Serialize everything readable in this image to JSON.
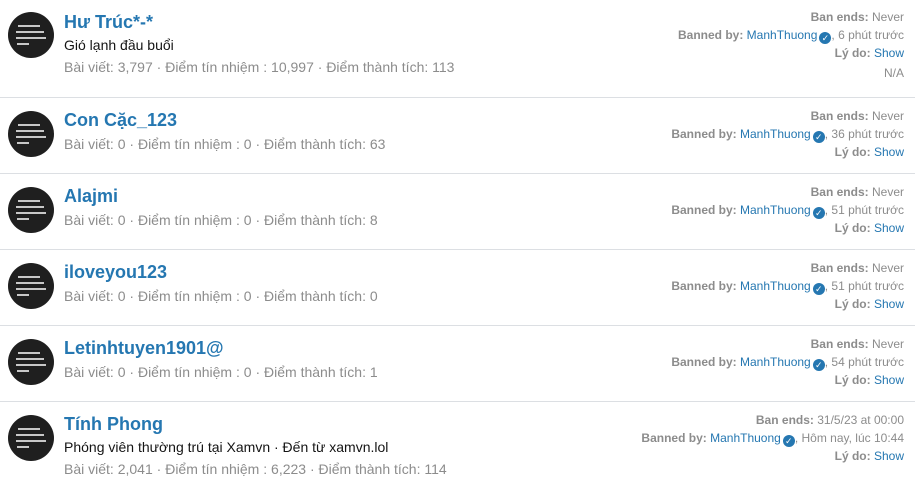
{
  "labels": {
    "ban_ends": "Ban ends:",
    "banned_by": "Banned by:",
    "reason": "Lý do:",
    "show": "Show",
    "stats_posts": "Bài viết:",
    "stats_reputation": "Điểm tín nhiệm :",
    "stats_achievements": "Điểm thành tích:",
    "sep": " · ",
    "comma": ", "
  },
  "icons": {
    "avatar": "avatar-image",
    "verified": "verified-check-icon"
  },
  "users": [
    {
      "name": "Hư Trúc*-*",
      "blurb": "Gió lạnh đầu buổi",
      "posts": "3,797",
      "reputation": "10,997",
      "achievements": "113",
      "ban_ends": "Never",
      "banned_by": "ManhThuong",
      "banned_when": "6 phút trước",
      "extra": "N/A"
    },
    {
      "name": "Con Cặc_123",
      "posts": "0",
      "reputation": "0",
      "achievements": "63",
      "ban_ends": "Never",
      "banned_by": "ManhThuong",
      "banned_when": "36 phút trước"
    },
    {
      "name": "Alajmi",
      "posts": "0",
      "reputation": "0",
      "achievements": "8",
      "ban_ends": "Never",
      "banned_by": "ManhThuong",
      "banned_when": "51 phút trước"
    },
    {
      "name": "iloveyou123",
      "posts": "0",
      "reputation": "0",
      "achievements": "0",
      "ban_ends": "Never",
      "banned_by": "ManhThuong",
      "banned_when": "51 phút trước"
    },
    {
      "name": "Letinhtuyen1901@",
      "posts": "0",
      "reputation": "0",
      "achievements": "1",
      "ban_ends": "Never",
      "banned_by": "ManhThuong",
      "banned_when": "54 phút trước"
    },
    {
      "name": "Tính Phong",
      "blurb": "Phóng viên thường trú tại Xamvn · Đến từ xamvn.lol",
      "posts": "2,041",
      "reputation": "6,223",
      "achievements": "114",
      "ban_ends": "31/5/23 at 00:00",
      "banned_by": "ManhThuong",
      "banned_when": "Hôm nay, lúc 10:44"
    }
  ]
}
